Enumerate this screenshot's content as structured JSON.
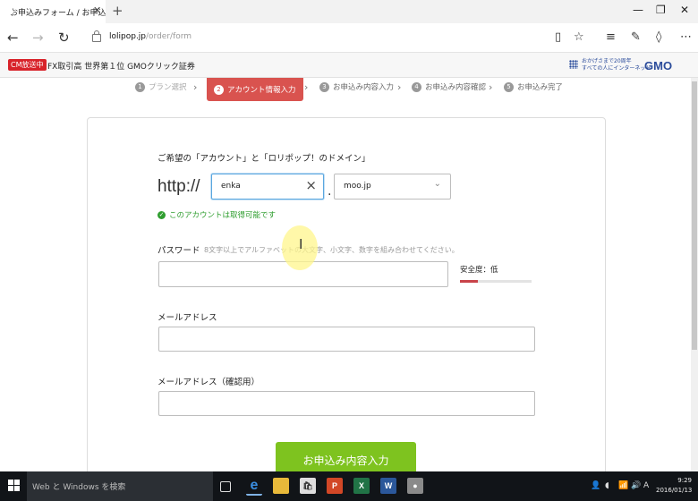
{
  "browser": {
    "tab_title": "お申込みフォーム / お申込",
    "tab_close": "✕",
    "new_tab": "+",
    "url_domain": "lolipop.jp",
    "url_path": "/order/form",
    "window_controls": [
      "—",
      "❐",
      "✕"
    ]
  },
  "ad": {
    "badge": "CM放送中",
    "text": "FX取引高 世界第１位 GMOクリック証券",
    "gmo_small_line1": "おかげさまで20周年",
    "gmo_small_line2": "すべての人にインターネット",
    "gmo_logo": "GMO"
  },
  "steps": [
    {
      "num": "1",
      "label": "プラン選択"
    },
    {
      "num": "2",
      "label": "アカウント情報入力"
    },
    {
      "num": "3",
      "label": "お申込み内容入力"
    },
    {
      "num": "4",
      "label": "お申込み内容確認"
    },
    {
      "num": "5",
      "label": "お申込み完了"
    }
  ],
  "form": {
    "domain_label": "ご希望の「アカウント」と「ロリポップ！のドメイン」",
    "http_prefix": "http://",
    "account_value": "enka",
    "dot": ".",
    "domain_value": "moo.jp",
    "available_msg": "このアカウントは取得可能です",
    "password_label": "パスワード",
    "password_hint": "8文字以上でアルファベットの大文字、小文字、数字を組み合わせてください。",
    "strength_label": "安全度：低",
    "strength_level": 0.25,
    "email_label": "メールアドレス",
    "email_confirm_label": "メールアドレス（確認用）",
    "submit_label": "お申込み内容入力"
  },
  "taskbar": {
    "search_text": "Web と Windows を検索",
    "time": "9:29",
    "date": "2016/01/13",
    "ime": "A"
  },
  "colors": {
    "accent_red": "#d9534f",
    "submit_green": "#7ec31f",
    "ok_green": "#2f9e2f",
    "gmo_blue": "#2b4c9b"
  }
}
